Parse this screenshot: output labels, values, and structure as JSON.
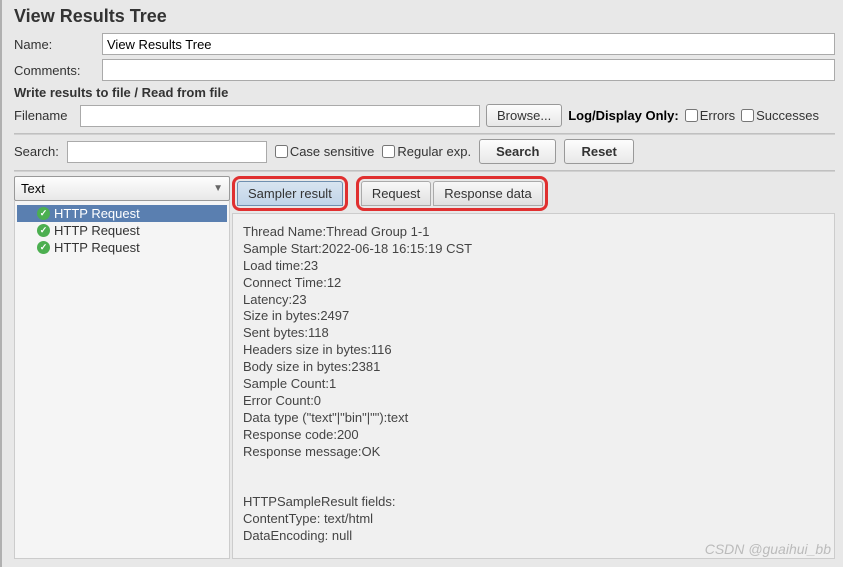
{
  "title": "View Results Tree",
  "name": {
    "label": "Name:",
    "value": "View Results Tree"
  },
  "comments": {
    "label": "Comments:",
    "value": ""
  },
  "file_section_label": "Write results to file / Read from file",
  "filename": {
    "label": "Filename",
    "value": "",
    "browse": "Browse..."
  },
  "log_display": {
    "label": "Log/Display Only:",
    "errors": "Errors",
    "successes": "Successes"
  },
  "search": {
    "label": "Search:",
    "value": "",
    "case_sensitive": "Case sensitive",
    "regular_exp": "Regular exp.",
    "search_btn": "Search",
    "reset_btn": "Reset"
  },
  "dropdown": {
    "value": "Text"
  },
  "tree": {
    "items": [
      {
        "label": "HTTP Request",
        "selected": true
      },
      {
        "label": "HTTP Request",
        "selected": false
      },
      {
        "label": "HTTP Request",
        "selected": false
      }
    ]
  },
  "tabs": {
    "sampler_result": "Sampler result",
    "request": "Request",
    "response_data": "Response data"
  },
  "result_content": "Thread Name:Thread Group 1-1\nSample Start:2022-06-18 16:15:19 CST\nLoad time:23\nConnect Time:12\nLatency:23\nSize in bytes:2497\nSent bytes:118\nHeaders size in bytes:116\nBody size in bytes:2381\nSample Count:1\nError Count:0\nData type (\"text\"|\"bin\"|\"\"):text\nResponse code:200\nResponse message:OK\n\n\nHTTPSampleResult fields:\nContentType: text/html\nDataEncoding: null",
  "watermark": "CSDN @guaihui_bb"
}
